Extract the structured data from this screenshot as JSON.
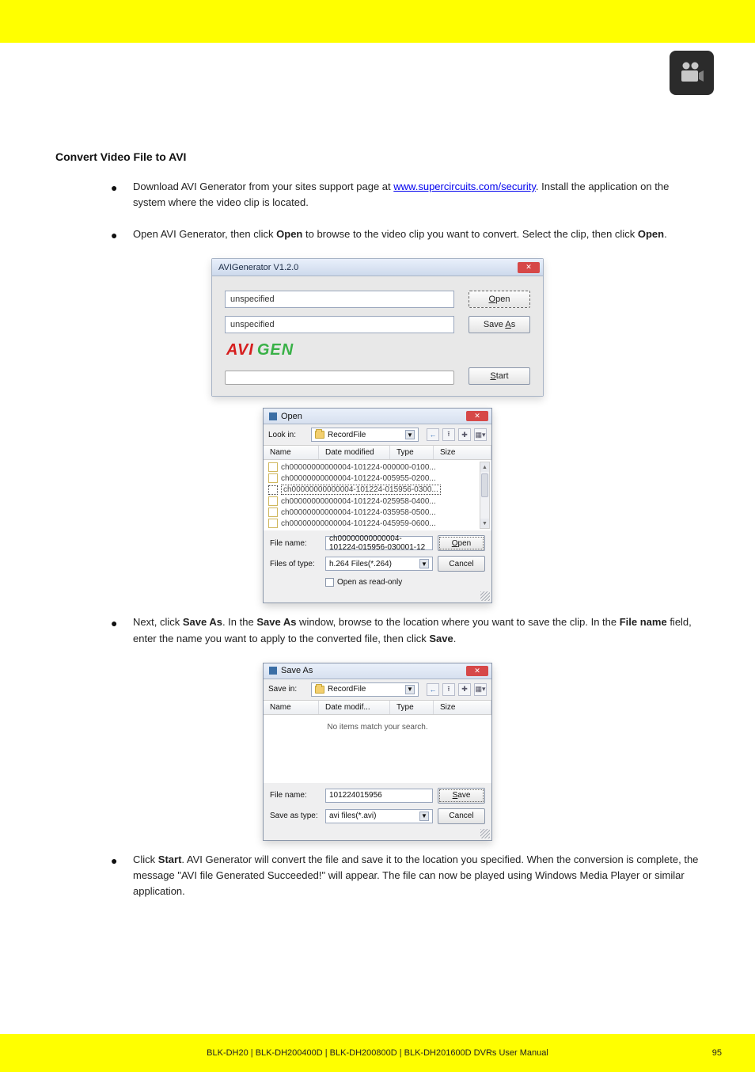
{
  "header": {
    "top_bar_color": "#ffff00"
  },
  "title": "Convert Video File to AVI",
  "bullets": {
    "b1_prefix": "Download AVI Generator from your sites support page at",
    "b1_link": "www.supercircuits.com/security",
    "b1_suffix": ". Install the application on the system where the video clip is located.",
    "b2_p1": "Open AVI Generator, then click ",
    "b2_strong": "Open",
    "b2_p2": " to browse to the video clip you want to convert. Select the clip, then click ",
    "b2_strong2": "Open",
    "b2_p3": ".",
    "b3_p1": "Next, click ",
    "b3_strong": "Save As",
    "b3_p2": ". In the ",
    "b3_strong2": "Save As",
    "b3_p3": " window, browse to the location where you want to save the clip. In the ",
    "b3_strong3": "File name",
    "b3_p4": " field, enter the name you want to apply to the converted file, then click ",
    "b3_strong4": "Save",
    "b3_p5": ".",
    "b4_p1": "Click ",
    "b4_strong": "Start",
    "b4_p2": ". AVI Generator will convert the file and save it to the location you specified. When the conversion is complete, the message \"AVI file Generated Succeeded!\" will appear. The file can now be played using Windows Media Player or similar application."
  },
  "avi_win": {
    "title": "AVIGenerator V1.2.0",
    "unspecified1": "unspecified",
    "unspecified2": "unspecified",
    "open_label": "Open",
    "saveas_label": "Save As",
    "start_label": "Start",
    "logo_avi": "AVI",
    "logo_gen": "GEN"
  },
  "open_win": {
    "title": "Open",
    "lookin_label": "Look in:",
    "folder": "RecordFile",
    "cols": {
      "name": "Name",
      "dm": "Date modified",
      "type": "Type",
      "size": "Size"
    },
    "files": [
      "ch00000000000004-101224-000000-0100...",
      "ch00000000000004-101224-005955-0200...",
      "ch00000000000004-101224-015956-0300...",
      "ch00000000000004-101224-025958-0400...",
      "ch00000000000004-101224-035958-0500...",
      "ch00000000000004-101224-045959-0600..."
    ],
    "filename_label": "File name:",
    "filename_value": "ch00000000000004-101224-015956-030001-12",
    "filetype_label": "Files of type:",
    "filetype_value": "h.264 Files(*.264)",
    "open_btn": "Open",
    "cancel_btn": "Cancel",
    "readonly": "Open as read-only"
  },
  "save_win": {
    "title": "Save As",
    "savein_label": "Save in:",
    "folder": "RecordFile",
    "cols": {
      "name": "Name",
      "dm": "Date modif...",
      "type": "Type",
      "size": "Size"
    },
    "empty": "No items match your search.",
    "filename_label": "File name:",
    "filename_value": "101224015956",
    "filetype_label": "Save as type:",
    "filetype_value": "avi files(*.avi)",
    "save_btn": "Save",
    "cancel_btn": "Cancel"
  },
  "footer": {
    "left": "BLK-DH20 | BLK-DH200400D | BLK-DH200800D | BLK-DH201600D DVRs User Manual",
    "page": "95"
  }
}
